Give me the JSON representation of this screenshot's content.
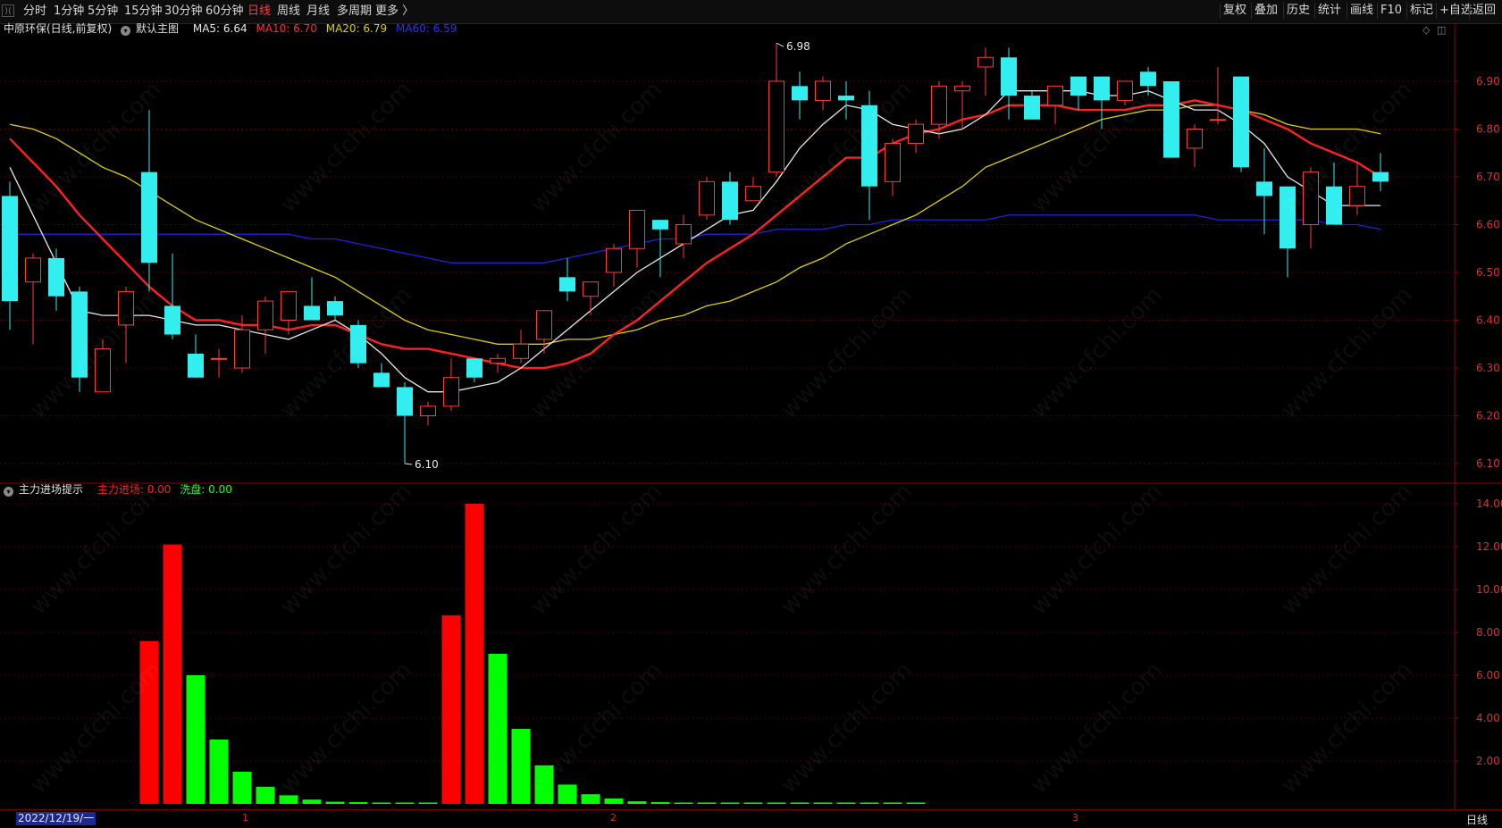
{
  "toolbar": {
    "corner_icon": "collapse-icon",
    "left_items": [
      {
        "label": "分时",
        "active": false
      },
      {
        "label": "1分钟",
        "active": false
      },
      {
        "label": "5分钟",
        "active": false
      },
      {
        "label": "15分钟",
        "active": false
      },
      {
        "label": "30分钟",
        "active": false
      },
      {
        "label": "60分钟",
        "active": false
      },
      {
        "label": "日线",
        "active": true
      },
      {
        "label": "周线",
        "active": false
      },
      {
        "label": "月线",
        "active": false
      },
      {
        "label": "多周期",
        "active": false
      },
      {
        "label": "更多 〉",
        "active": false
      }
    ],
    "right_items": [
      "复权",
      "叠加",
      "历史",
      "统计",
      "画线",
      "F10",
      "标记",
      "+自选",
      "返回"
    ]
  },
  "main_info": {
    "stock": "中原环保(日线,前复权)",
    "template": "默认主图",
    "ma5": "MA5: 6.64",
    "ma10": "MA10: 6.70",
    "ma20": "MA20: 6.79",
    "ma60": "MA60: 6.59",
    "high_label": "6.98",
    "low_label": "6.10"
  },
  "indicator_info": {
    "name": "主力进场提示",
    "zljc": "主力进场: 0.00",
    "xp": "洗盘: 0.00"
  },
  "colors": {
    "up": "#ff3b3b",
    "down": "#33eeee",
    "ma5": "#e8e8e8",
    "ma10": "#ff2020",
    "ma20": "#e0d000",
    "ma60": "#2020dd",
    "bar_red": "#ff0000",
    "bar_green": "#00ff00",
    "axis": "#e03030"
  },
  "bottom": {
    "date": "2022/12/19/一",
    "period": "日线",
    "month_marks": [
      "1",
      "2",
      "3"
    ]
  },
  "watermark": "www.cfchi.com",
  "chart_data": [
    {
      "type": "candlestick",
      "ylim": [
        6.05,
        7.0
      ],
      "y_ticks": [
        "6.90",
        "6.80",
        "6.70",
        "6.60",
        "6.50",
        "6.40",
        "6.30",
        "6.20",
        "6.10"
      ],
      "candles": [
        {
          "o": 6.66,
          "c": 6.44,
          "h": 6.69,
          "l": 6.38
        },
        {
          "o": 6.48,
          "c": 6.53,
          "h": 6.54,
          "l": 6.35
        },
        {
          "o": 6.53,
          "c": 6.45,
          "h": 6.55,
          "l": 6.42
        },
        {
          "o": 6.46,
          "c": 6.28,
          "h": 6.47,
          "l": 6.25
        },
        {
          "o": 6.25,
          "c": 6.34,
          "h": 6.36,
          "l": 6.25
        },
        {
          "o": 6.39,
          "c": 6.46,
          "h": 6.47,
          "l": 6.31
        },
        {
          "o": 6.71,
          "c": 6.52,
          "h": 6.84,
          "l": 6.46
        },
        {
          "o": 6.43,
          "c": 6.37,
          "h": 6.54,
          "l": 6.36
        },
        {
          "o": 6.33,
          "c": 6.28,
          "h": 6.37,
          "l": 6.28
        },
        {
          "o": 6.32,
          "c": 6.32,
          "h": 6.34,
          "l": 6.28
        },
        {
          "o": 6.3,
          "c": 6.38,
          "h": 6.41,
          "l": 6.29
        },
        {
          "o": 6.38,
          "c": 6.44,
          "h": 6.45,
          "l": 6.33
        },
        {
          "o": 6.4,
          "c": 6.46,
          "h": 6.46,
          "l": 6.37
        },
        {
          "o": 6.43,
          "c": 6.4,
          "h": 6.49,
          "l": 6.4
        },
        {
          "o": 6.44,
          "c": 6.41,
          "h": 6.45,
          "l": 6.4
        },
        {
          "o": 6.39,
          "c": 6.31,
          "h": 6.4,
          "l": 6.3
        },
        {
          "o": 6.29,
          "c": 6.26,
          "h": 6.31,
          "l": 6.26
        },
        {
          "o": 6.26,
          "c": 6.2,
          "h": 6.27,
          "l": 6.1
        },
        {
          "o": 6.2,
          "c": 6.22,
          "h": 6.23,
          "l": 6.18
        },
        {
          "o": 6.22,
          "c": 6.28,
          "h": 6.32,
          "l": 6.21
        },
        {
          "o": 6.32,
          "c": 6.28,
          "h": 6.32,
          "l": 6.27
        },
        {
          "o": 6.31,
          "c": 6.32,
          "h": 6.33,
          "l": 6.29
        },
        {
          "o": 6.32,
          "c": 6.35,
          "h": 6.38,
          "l": 6.31
        },
        {
          "o": 6.36,
          "c": 6.42,
          "h": 6.42,
          "l": 6.33
        },
        {
          "o": 6.49,
          "c": 6.46,
          "h": 6.53,
          "l": 6.44
        },
        {
          "o": 6.45,
          "c": 6.48,
          "h": 6.48,
          "l": 6.41
        },
        {
          "o": 6.5,
          "c": 6.55,
          "h": 6.56,
          "l": 6.47
        },
        {
          "o": 6.55,
          "c": 6.63,
          "h": 6.63,
          "l": 6.51
        },
        {
          "o": 6.61,
          "c": 6.59,
          "h": 6.61,
          "l": 6.49
        },
        {
          "o": 6.56,
          "c": 6.6,
          "h": 6.62,
          "l": 6.53
        },
        {
          "o": 6.62,
          "c": 6.69,
          "h": 6.7,
          "l": 6.61
        },
        {
          "o": 6.69,
          "c": 6.61,
          "h": 6.71,
          "l": 6.6
        },
        {
          "o": 6.65,
          "c": 6.68,
          "h": 6.7,
          "l": 6.65
        },
        {
          "o": 6.71,
          "c": 6.9,
          "h": 6.98,
          "l": 6.7
        },
        {
          "o": 6.89,
          "c": 6.86,
          "h": 6.92,
          "l": 6.82
        },
        {
          "o": 6.86,
          "c": 6.9,
          "h": 6.91,
          "l": 6.84
        },
        {
          "o": 6.87,
          "c": 6.86,
          "h": 6.9,
          "l": 6.82
        },
        {
          "o": 6.85,
          "c": 6.68,
          "h": 6.88,
          "l": 6.61
        },
        {
          "o": 6.69,
          "c": 6.77,
          "h": 6.78,
          "l": 6.66
        },
        {
          "o": 6.77,
          "c": 6.81,
          "h": 6.82,
          "l": 6.75
        },
        {
          "o": 6.81,
          "c": 6.89,
          "h": 6.9,
          "l": 6.78
        },
        {
          "o": 6.88,
          "c": 6.89,
          "h": 6.9,
          "l": 6.8
        },
        {
          "o": 6.93,
          "c": 6.95,
          "h": 6.97,
          "l": 6.87
        },
        {
          "o": 6.95,
          "c": 6.87,
          "h": 6.97,
          "l": 6.82
        },
        {
          "o": 6.87,
          "c": 6.82,
          "h": 6.88,
          "l": 6.82
        },
        {
          "o": 6.85,
          "c": 6.89,
          "h": 6.89,
          "l": 6.81
        },
        {
          "o": 6.91,
          "c": 6.87,
          "h": 6.91,
          "l": 6.84
        },
        {
          "o": 6.91,
          "c": 6.86,
          "h": 6.91,
          "l": 6.8
        },
        {
          "o": 6.86,
          "c": 6.9,
          "h": 6.9,
          "l": 6.85
        },
        {
          "o": 6.92,
          "c": 6.89,
          "h": 6.93,
          "l": 6.87
        },
        {
          "o": 6.9,
          "c": 6.74,
          "h": 6.9,
          "l": 6.74
        },
        {
          "o": 6.76,
          "c": 6.8,
          "h": 6.81,
          "l": 6.72
        },
        {
          "o": 6.82,
          "c": 6.82,
          "h": 6.93,
          "l": 6.81
        },
        {
          "o": 6.91,
          "c": 6.72,
          "h": 6.91,
          "l": 6.71
        },
        {
          "o": 6.69,
          "c": 6.66,
          "h": 6.76,
          "l": 6.58
        },
        {
          "o": 6.68,
          "c": 6.55,
          "h": 6.68,
          "l": 6.49
        },
        {
          "o": 6.6,
          "c": 6.71,
          "h": 6.72,
          "l": 6.55
        },
        {
          "o": 6.68,
          "c": 6.6,
          "h": 6.73,
          "l": 6.6
        },
        {
          "o": 6.64,
          "c": 6.68,
          "h": 6.73,
          "l": 6.62
        },
        {
          "o": 6.71,
          "c": 6.69,
          "h": 6.75,
          "l": 6.67
        }
      ],
      "ma5": [
        6.72,
        6.62,
        6.52,
        6.42,
        6.41,
        6.41,
        6.41,
        6.4,
        6.39,
        6.39,
        6.38,
        6.37,
        6.36,
        6.38,
        6.4,
        6.37,
        6.33,
        6.28,
        6.25,
        6.25,
        6.26,
        6.27,
        6.3,
        6.34,
        6.38,
        6.42,
        6.46,
        6.5,
        6.53,
        6.56,
        6.59,
        6.62,
        6.63,
        6.69,
        6.76,
        6.81,
        6.85,
        6.84,
        6.81,
        6.8,
        6.79,
        6.8,
        6.83,
        6.88,
        6.88,
        6.88,
        6.88,
        6.87,
        6.87,
        6.88,
        6.86,
        6.84,
        6.84,
        6.81,
        6.77,
        6.7,
        6.67,
        6.64,
        6.64,
        6.64
      ],
      "ma10": [
        6.78,
        6.73,
        6.68,
        6.62,
        6.57,
        6.52,
        6.47,
        6.43,
        6.4,
        6.4,
        6.39,
        6.39,
        6.38,
        6.39,
        6.39,
        6.37,
        6.35,
        6.34,
        6.34,
        6.33,
        6.32,
        6.31,
        6.3,
        6.3,
        6.31,
        6.33,
        6.37,
        6.4,
        6.44,
        6.48,
        6.52,
        6.55,
        6.58,
        6.62,
        6.66,
        6.7,
        6.74,
        6.74,
        6.77,
        6.79,
        6.8,
        6.82,
        6.83,
        6.85,
        6.85,
        6.85,
        6.84,
        6.84,
        6.84,
        6.85,
        6.85,
        6.86,
        6.85,
        6.84,
        6.82,
        6.8,
        6.77,
        6.75,
        6.73,
        6.7
      ],
      "ma20": [
        6.81,
        6.8,
        6.78,
        6.75,
        6.72,
        6.7,
        6.67,
        6.64,
        6.61,
        6.59,
        6.57,
        6.55,
        6.53,
        6.51,
        6.49,
        6.46,
        6.43,
        6.4,
        6.38,
        6.37,
        6.36,
        6.35,
        6.35,
        6.35,
        6.36,
        6.36,
        6.37,
        6.38,
        6.4,
        6.41,
        6.43,
        6.44,
        6.46,
        6.48,
        6.51,
        6.53,
        6.56,
        6.58,
        6.6,
        6.62,
        6.65,
        6.68,
        6.72,
        6.74,
        6.76,
        6.78,
        6.8,
        6.82,
        6.83,
        6.84,
        6.84,
        6.85,
        6.85,
        6.84,
        6.83,
        6.81,
        6.8,
        6.8,
        6.8,
        6.79
      ],
      "ma60": [
        6.58,
        6.58,
        6.58,
        6.58,
        6.58,
        6.58,
        6.58,
        6.58,
        6.58,
        6.58,
        6.58,
        6.58,
        6.58,
        6.57,
        6.57,
        6.56,
        6.55,
        6.54,
        6.53,
        6.52,
        6.52,
        6.52,
        6.52,
        6.52,
        6.53,
        6.54,
        6.55,
        6.56,
        6.57,
        6.57,
        6.58,
        6.58,
        6.58,
        6.59,
        6.59,
        6.59,
        6.6,
        6.6,
        6.61,
        6.61,
        6.61,
        6.61,
        6.61,
        6.62,
        6.62,
        6.62,
        6.62,
        6.62,
        6.62,
        6.62,
        6.62,
        6.62,
        6.61,
        6.61,
        6.61,
        6.61,
        6.61,
        6.6,
        6.6,
        6.59
      ]
    },
    {
      "type": "bar",
      "title": "主力进场提示",
      "ylim": [
        0,
        14.8
      ],
      "y_ticks": [
        "14.00",
        "12.00",
        "10.00",
        "8.00",
        "6.00",
        "4.00",
        "2.00"
      ],
      "series": [
        {
          "name": "主力进场",
          "values": [
            0,
            0,
            0,
            7.6,
            12.1,
            0,
            0,
            0,
            0,
            0,
            0,
            0,
            0,
            0,
            0,
            0,
            8.8,
            14.0,
            0,
            0,
            0,
            0,
            0,
            0,
            0,
            0,
            0,
            0,
            0,
            0,
            0,
            0,
            0,
            0,
            0,
            0,
            0,
            0,
            0,
            0,
            0,
            0,
            0,
            0,
            0,
            0,
            0,
            0,
            0,
            0,
            0,
            0,
            0,
            0,
            0,
            0,
            0,
            0,
            0,
            0
          ]
        },
        {
          "name": "洗盘",
          "values": [
            0,
            0,
            0,
            0,
            0,
            6.0,
            3.0,
            1.5,
            0.8,
            0.4,
            0.2,
            0.1,
            0.08,
            0.06,
            0.05,
            0.04,
            0,
            0,
            7.0,
            3.5,
            1.8,
            0.9,
            0.45,
            0.25,
            0.12,
            0.08,
            0.06,
            0.05,
            0.05,
            0.05,
            0.05,
            0.05,
            0.05,
            0.05,
            0.05,
            0.05,
            0.05,
            0,
            0,
            0,
            0,
            0,
            0,
            0,
            0,
            0,
            0,
            0,
            0,
            0,
            0,
            0,
            0,
            0,
            0,
            0,
            0,
            0,
            0,
            0
          ]
        }
      ]
    }
  ]
}
